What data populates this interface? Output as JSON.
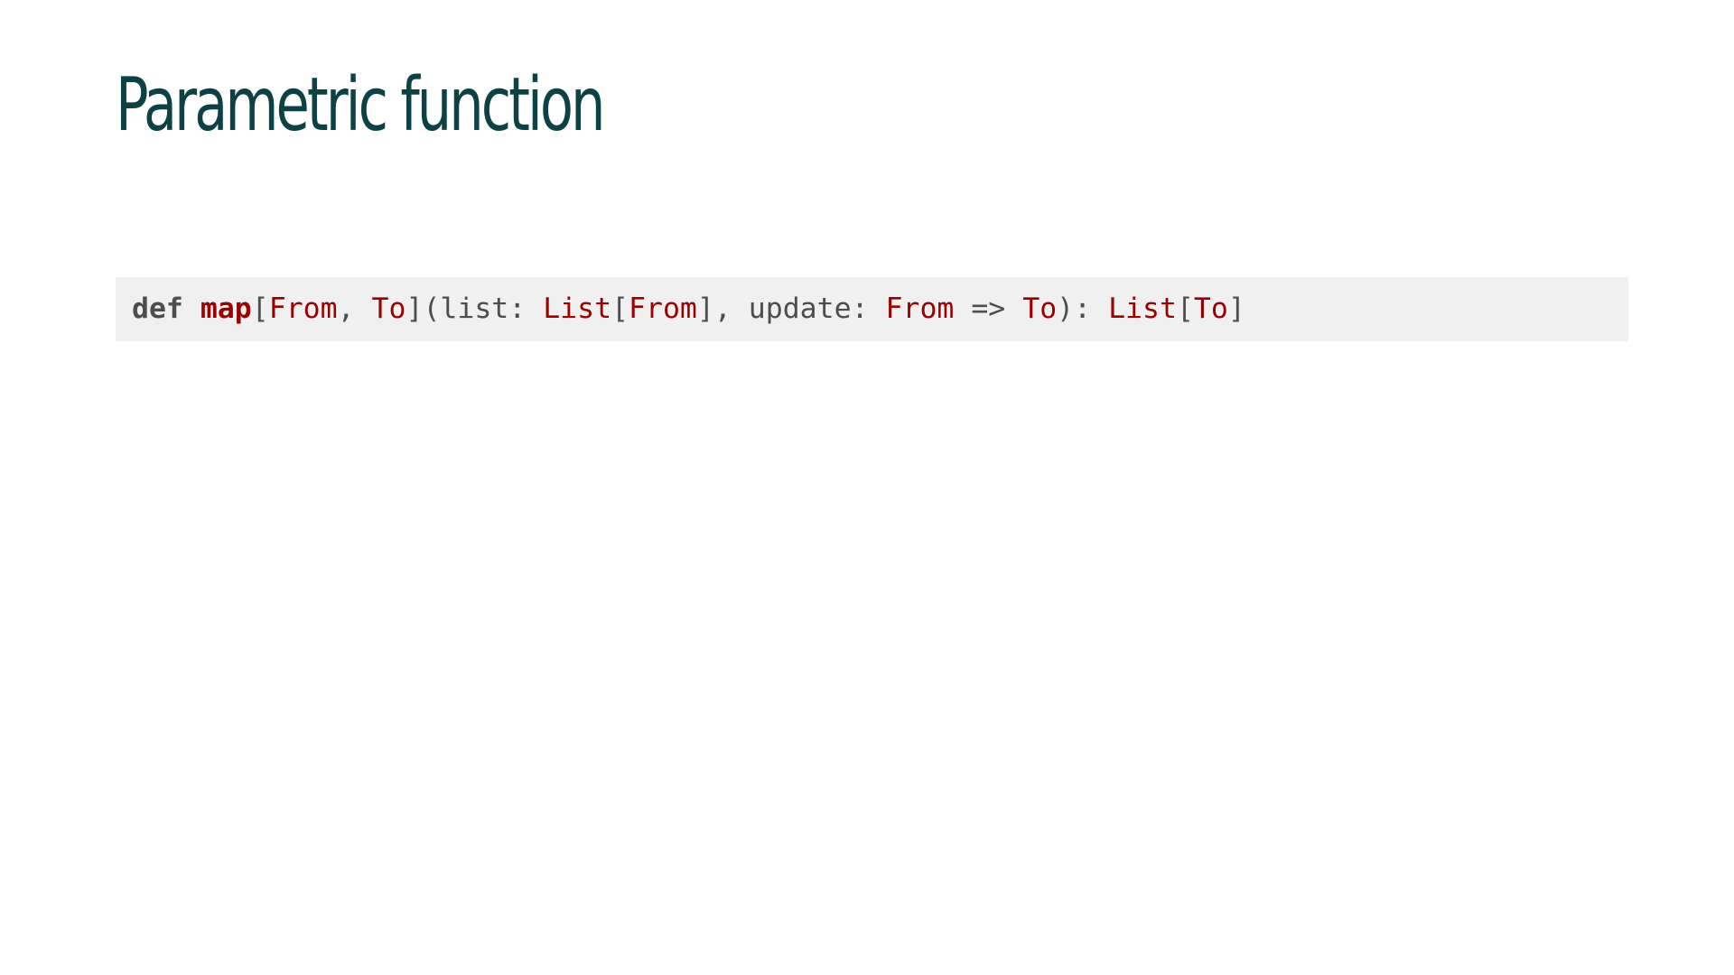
{
  "title": {
    "text": "Parametric function",
    "color": "#0d4146"
  },
  "code": {
    "background": "#f0f0f0",
    "default_color": "#4d4d4d",
    "type_color": "#990000",
    "tokens": [
      {
        "text": "def",
        "role": "keyword",
        "color": "#4d4d4d",
        "bold": true
      },
      {
        "text": " ",
        "role": "space",
        "color": "#4d4d4d",
        "bold": false
      },
      {
        "text": "map",
        "role": "function-name",
        "color": "#990000",
        "bold": true
      },
      {
        "text": "[",
        "role": "punctuation",
        "color": "#4d4d4d",
        "bold": false
      },
      {
        "text": "From",
        "role": "type",
        "color": "#990000",
        "bold": false
      },
      {
        "text": ", ",
        "role": "punctuation",
        "color": "#4d4d4d",
        "bold": false
      },
      {
        "text": "To",
        "role": "type",
        "color": "#990000",
        "bold": false
      },
      {
        "text": "](list: ",
        "role": "plain",
        "color": "#4d4d4d",
        "bold": false
      },
      {
        "text": "List",
        "role": "type",
        "color": "#990000",
        "bold": false
      },
      {
        "text": "[",
        "role": "punctuation",
        "color": "#4d4d4d",
        "bold": false
      },
      {
        "text": "From",
        "role": "type",
        "color": "#990000",
        "bold": false
      },
      {
        "text": "], update: ",
        "role": "plain",
        "color": "#4d4d4d",
        "bold": false
      },
      {
        "text": "From",
        "role": "type",
        "color": "#990000",
        "bold": false
      },
      {
        "text": " => ",
        "role": "operator",
        "color": "#4d4d4d",
        "bold": false
      },
      {
        "text": "To",
        "role": "type",
        "color": "#990000",
        "bold": false
      },
      {
        "text": "): ",
        "role": "punctuation",
        "color": "#4d4d4d",
        "bold": false
      },
      {
        "text": "List",
        "role": "type",
        "color": "#990000",
        "bold": false
      },
      {
        "text": "[",
        "role": "punctuation",
        "color": "#4d4d4d",
        "bold": false
      },
      {
        "text": "To",
        "role": "type",
        "color": "#990000",
        "bold": false
      },
      {
        "text": "]",
        "role": "punctuation",
        "color": "#4d4d4d",
        "bold": false
      }
    ]
  }
}
